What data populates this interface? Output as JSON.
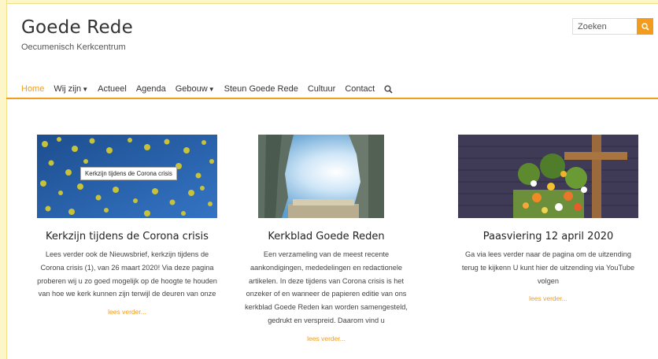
{
  "site": {
    "title": "Goede Rede",
    "tagline": "Oecumenisch Kerkcentrum"
  },
  "search": {
    "placeholder": "Zoeken",
    "icon": "search-icon",
    "button_color": "#f29c1f"
  },
  "nav": {
    "items": [
      {
        "label": "Home",
        "active": true
      },
      {
        "label": "Wij zijn",
        "dropdown": true
      },
      {
        "label": "Actueel"
      },
      {
        "label": "Agenda"
      },
      {
        "label": "Gebouw",
        "dropdown": true
      },
      {
        "label": "Steun Goede Rede"
      },
      {
        "label": "Cultuur"
      },
      {
        "label": "Contact"
      }
    ],
    "search_icon": "search-icon",
    "accent": "#f29c1f"
  },
  "posts": [
    {
      "title": "Kerkzijn tijdens de Corona crisis",
      "image_tooltip": "Kerkzijn tijdens de Corona crisis",
      "excerpt": "Lees verder ook de Nieuwsbrief, kerkzijn tijdens de Corona crisis (1), van 26 maart 2020! Via deze pagina proberen wij u zo goed mogelijk op de hoogte te houden van hoe we kerk kunnen zijn terwijl de deuren van onze",
      "more": "lees verder..."
    },
    {
      "title": "Kerkblad Goede Reden",
      "excerpt": "Een verzameling van de meest recente aankondigingen, mededelingen en redactionele artikelen. In deze tijdens van Corona crisis is het onzeker of en wanneer de papieren editie van ons kerkblad Goede Reden kan worden samengesteld, gedrukt en verspreid. Daarom vind u",
      "more": "lees verder..."
    },
    {
      "title": "Paasviering 12 april 2020",
      "excerpt": "Ga via lees verder naar de pagina om de uitzending terug te kijkenn U kunt hier de uitzending via YouTube volgen",
      "more": "lees verder..."
    }
  ]
}
